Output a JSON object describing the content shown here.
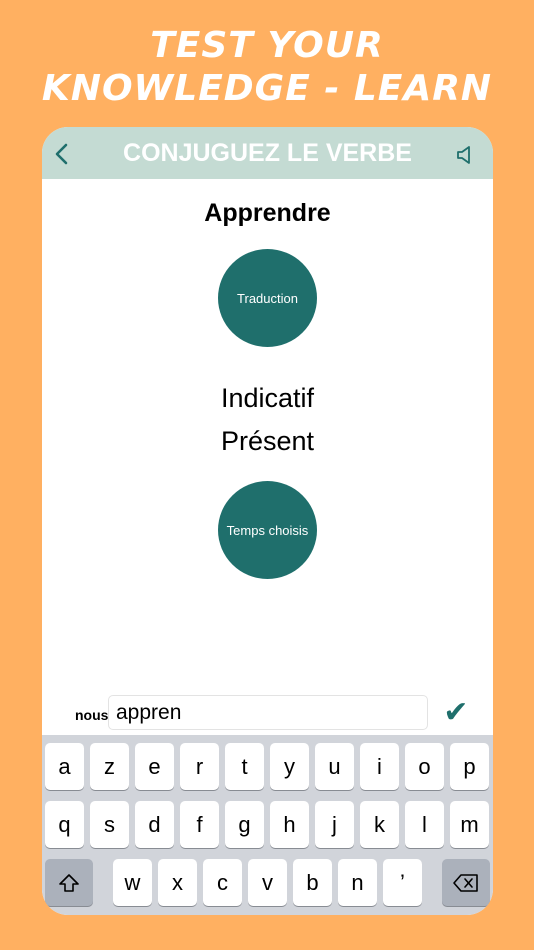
{
  "promo": {
    "line1": "TEST YOUR",
    "line2": "KNOWLEDGE - LEARN"
  },
  "navbar": {
    "title": "CONJUGUEZ LE VERBE",
    "back_icon": "chevron-left-icon",
    "speaker_icon": "speaker-icon"
  },
  "main": {
    "verb": "Apprendre",
    "translation_label": "Traduction",
    "mode": "Indicatif",
    "tense": "Présent",
    "chosen_tense_label": "Temps choisis"
  },
  "answer": {
    "pronoun": "nous",
    "value": "appren",
    "submit_icon": "checkmark-icon"
  },
  "keyboard": {
    "row1": [
      "a",
      "z",
      "e",
      "r",
      "t",
      "y",
      "u",
      "i",
      "o",
      "p"
    ],
    "row2": [
      "q",
      "s",
      "d",
      "f",
      "g",
      "h",
      "j",
      "k",
      "l",
      "m"
    ],
    "row3": [
      "w",
      "x",
      "c",
      "v",
      "b",
      "n",
      "’"
    ],
    "shift_icon": "shift-icon",
    "backspace_icon": "backspace-icon"
  },
  "colors": {
    "background": "#FFB061",
    "navbar": "#C4DBD3",
    "accent": "#1F6F6C",
    "keyboard": "#D1D4DA"
  }
}
